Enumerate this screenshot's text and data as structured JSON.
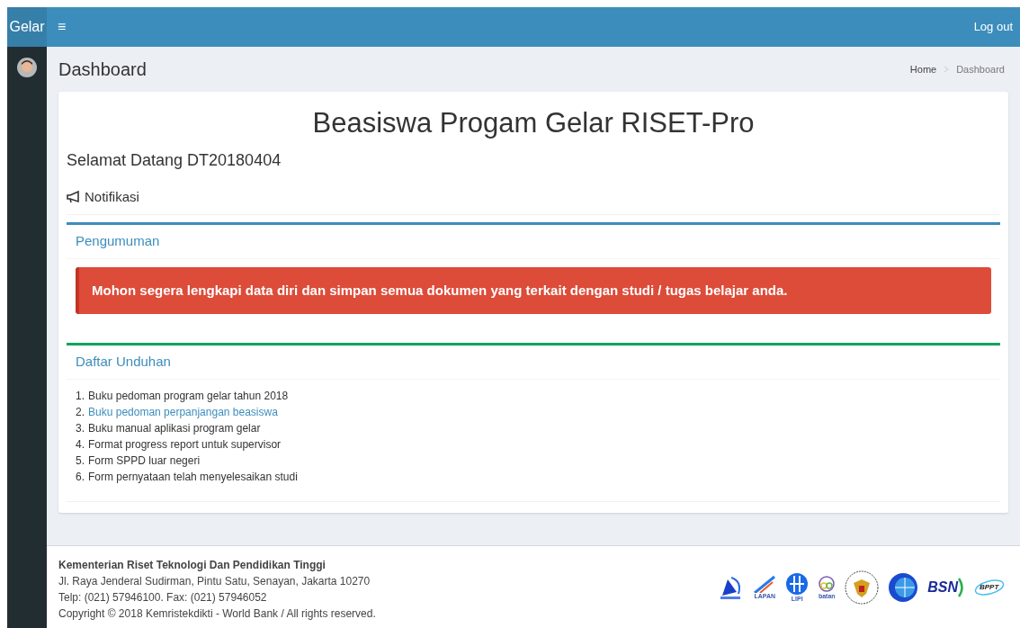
{
  "navbar": {
    "brand": "Gelar",
    "menu_icon": "≡",
    "logout": "Log out"
  },
  "header": {
    "title": "Dashboard",
    "breadcrumb": [
      "Home",
      "Dashboard"
    ]
  },
  "main": {
    "title": "Beasiswa Progam Gelar RISET-Pro",
    "welcome": "Selamat Datang DT20180404",
    "notification_label": "Notifikasi",
    "announcement": {
      "title": "Pengumuman",
      "alert": "Mohon segera lengkapi data diri dan simpan semua dokumen yang terkait dengan studi / tugas belajar anda."
    },
    "downloads": {
      "title": "Daftar Unduhan",
      "items": [
        {
          "number": "1.",
          "label": "Buku pedoman program gelar tahun 2018",
          "hovered": false
        },
        {
          "number": "2.",
          "label": "Buku pedoman perpanjangan beasiswa",
          "hovered": true
        },
        {
          "number": "3.",
          "label": "Buku manual aplikasi program gelar",
          "hovered": false
        },
        {
          "number": "4.",
          "label": "Format progress report untuk supervisor",
          "hovered": false
        },
        {
          "number": "5.",
          "label": "Form SPPD luar negeri",
          "hovered": false
        },
        {
          "number": "6.",
          "label": "Form pernyataan telah menyelesaikan studi",
          "hovered": false
        }
      ]
    }
  },
  "footer": {
    "org": "Kementerian Riset Teknologi Dan Pendidikan Tinggi",
    "address": "Jl. Raya Jenderal Sudirman, Pintu Satu, Senayan, Jakarta 10270",
    "phone": "Telp: (021) 57946100. Fax: (021) 57946052",
    "copyright": "Copyright © 2018 Kemristekdikti - World Bank / All rights reserved.",
    "logos": [
      {
        "kind": "dish"
      },
      {
        "kind": "rocket",
        "label": "LAPAN"
      },
      {
        "kind": "circle",
        "label": "LIPI"
      },
      {
        "kind": "atom",
        "label": "batan"
      },
      {
        "kind": "emblem"
      },
      {
        "kind": "globe"
      },
      {
        "kind": "wordmark",
        "label": "BSN"
      },
      {
        "kind": "ring",
        "label": "BPPT"
      }
    ]
  }
}
